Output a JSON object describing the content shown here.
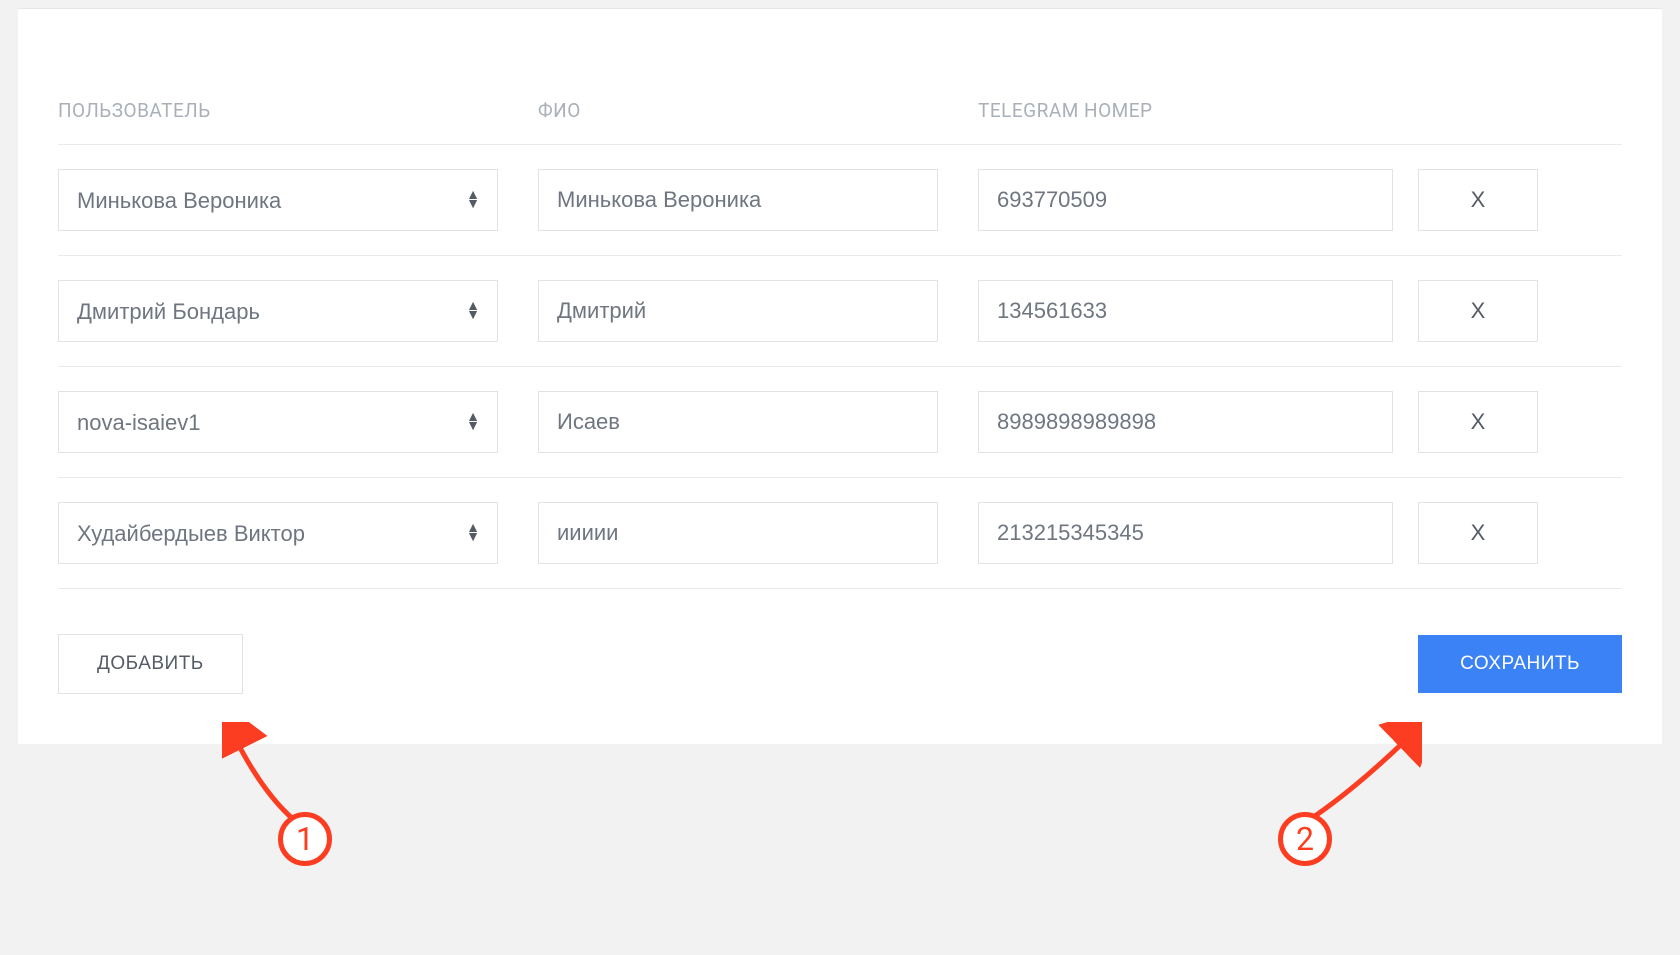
{
  "headers": {
    "user": "ПОЛЬЗОВАТЕЛЬ",
    "fio": "ФИО",
    "telegram": "TELEGRAM НОМЕР"
  },
  "rows": [
    {
      "user": "Минькова Вероника",
      "fio": "Минькова Вероника",
      "telegram": "693770509",
      "delete": "X"
    },
    {
      "user": "Дмитрий Бондарь",
      "fio": "Дмитрий",
      "telegram": "134561633",
      "delete": "X"
    },
    {
      "user": "nova-isaiev1",
      "fio": "Исаев",
      "telegram": "8989898989898",
      "delete": "X"
    },
    {
      "user": "Худайбердыев Виктор",
      "fio": "иииии",
      "telegram": "213215345345",
      "delete": "X"
    }
  ],
  "buttons": {
    "add": "ДОБАВИТЬ",
    "save": "СОХРАНИТЬ"
  },
  "annotations": {
    "one": "1",
    "two": "2"
  }
}
